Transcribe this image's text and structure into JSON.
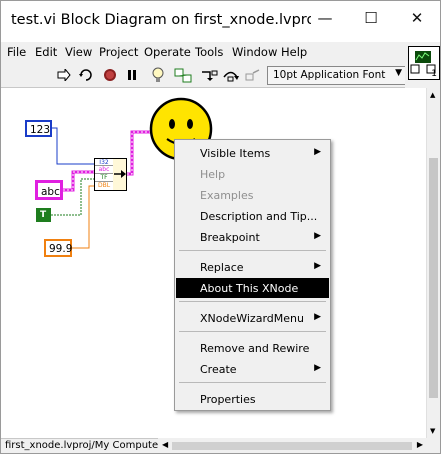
{
  "window": {
    "title": "test.vi Block Diagram on first_xnode.lvproj/M…",
    "minimize_glyph": "—",
    "maximize_glyph": "☐",
    "close_glyph": "✕"
  },
  "menu": {
    "items": [
      "File",
      "Edit",
      "View",
      "Project",
      "Operate",
      "Tools",
      "Window",
      "Help"
    ]
  },
  "toolbar": {
    "icons": [
      "run-arrow-icon",
      "run-continuously-icon",
      "abort-icon",
      "pause-icon",
      "highlight-execution-icon",
      "retain-wire-values-icon",
      "step-into-icon",
      "step-over-icon",
      "step-out-icon"
    ],
    "font_select": "10pt Application Font"
  },
  "connector_pane": {
    "number": "1"
  },
  "diagram": {
    "numeric_constant": "123",
    "string_constant": "abc",
    "boolean_constant": "T",
    "double_constant": "99.9",
    "xnode_rows": [
      "I32",
      "abc",
      "TF",
      "DBL"
    ]
  },
  "context_menu": {
    "items": [
      {
        "label": "Visible Items",
        "submenu": true,
        "disabled": false
      },
      {
        "label": "Help",
        "submenu": false,
        "disabled": true
      },
      {
        "label": "Examples",
        "submenu": false,
        "disabled": true
      },
      {
        "label": "Description and Tip...",
        "submenu": false,
        "disabled": false
      },
      {
        "label": "Breakpoint",
        "submenu": true,
        "disabled": false
      },
      {
        "label": "Replace",
        "submenu": true,
        "disabled": false
      },
      {
        "label": "About This XNode",
        "submenu": false,
        "disabled": false,
        "selected": true
      },
      {
        "label": "XNodeWizardMenu",
        "submenu": true,
        "disabled": false
      },
      {
        "label": "Remove and Rewire",
        "submenu": false,
        "disabled": false
      },
      {
        "label": "Create",
        "submenu": true,
        "disabled": false
      },
      {
        "label": "Properties",
        "submenu": false,
        "disabled": false
      }
    ]
  },
  "status": {
    "context": "first_xnode.lvproj/My Computer"
  },
  "colors": {
    "numeric_wire": "#1a3cc8",
    "string_wire": "#e020e0",
    "boolean_wire": "#1e7d1e",
    "double_wire": "#f08010",
    "menu_highlight": "#000000",
    "smiley_face": "#ffe400"
  }
}
